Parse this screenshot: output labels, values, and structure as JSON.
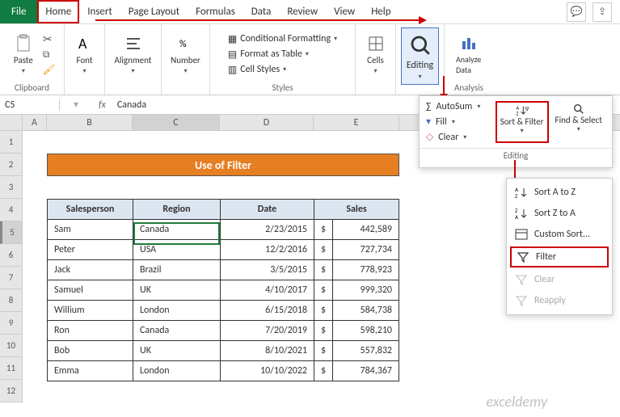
{
  "menu": {
    "file": "File",
    "home": "Home",
    "insert": "Insert",
    "pagelayout": "Page Layout",
    "formulas": "Formulas",
    "data": "Data",
    "review": "Review",
    "view": "View",
    "help": "Help"
  },
  "ribbon": {
    "clipboard": {
      "label": "Clipboard",
      "paste": "Paste"
    },
    "font": {
      "label": "Font",
      "btn": "Font"
    },
    "alignment": {
      "label": "Alignment",
      "btn": "Alignment"
    },
    "number": {
      "label": "Number",
      "btn": "Number"
    },
    "styles": {
      "label": "Styles",
      "cond": "Conditional Formatting",
      "table": "Format as Table",
      "cell": "Cell Styles"
    },
    "cells": {
      "label": "Cells",
      "btn": "Cells"
    },
    "editing": {
      "label": "Editing",
      "btn": "Editing"
    },
    "analysis": {
      "label": "Analysis",
      "btn": "Analyze Data"
    }
  },
  "namebox": "C5",
  "fvalue": "Canada",
  "title_cell": "Use of Filter",
  "headers": {
    "sp": "Salesperson",
    "rg": "Region",
    "dt": "Date",
    "sl": "Sales"
  },
  "rows": [
    {
      "sp": "Sam",
      "rg": "Canada",
      "dt": "2/23/2015",
      "cur": "$",
      "sl": "442,589"
    },
    {
      "sp": "Peter",
      "rg": "USA",
      "dt": "12/2/2016",
      "cur": "$",
      "sl": "727,734"
    },
    {
      "sp": "Jack",
      "rg": "Brazil",
      "dt": "3/5/2015",
      "cur": "$",
      "sl": "778,923"
    },
    {
      "sp": "Samuel",
      "rg": "UK",
      "dt": "4/10/2017",
      "cur": "$",
      "sl": "999,320"
    },
    {
      "sp": "Willium",
      "rg": "London",
      "dt": "6/15/2018",
      "cur": "$",
      "sl": "584,738"
    },
    {
      "sp": "Ron",
      "rg": "Canada",
      "dt": "7/20/2019",
      "cur": "$",
      "sl": "598,210"
    },
    {
      "sp": "Bob",
      "rg": "UK",
      "dt": "8/10/2021",
      "cur": "$",
      "sl": "557,832"
    },
    {
      "sp": "Emma",
      "rg": "London",
      "dt": "10/10/2022",
      "cur": "$",
      "sl": "784,367"
    }
  ],
  "popup": {
    "autosum": "AutoSum",
    "fill": "Fill",
    "clear": "Clear",
    "sortfilter": "Sort & Filter",
    "findselect": "Find & Select",
    "editing": "Editing"
  },
  "sfmenu": {
    "az": "Sort A to Z",
    "za": "Sort Z to A",
    "custom": "Custom Sort...",
    "filter": "Filter",
    "clear": "Clear",
    "reapply": "Reapply"
  },
  "watermark": "exceldemy"
}
